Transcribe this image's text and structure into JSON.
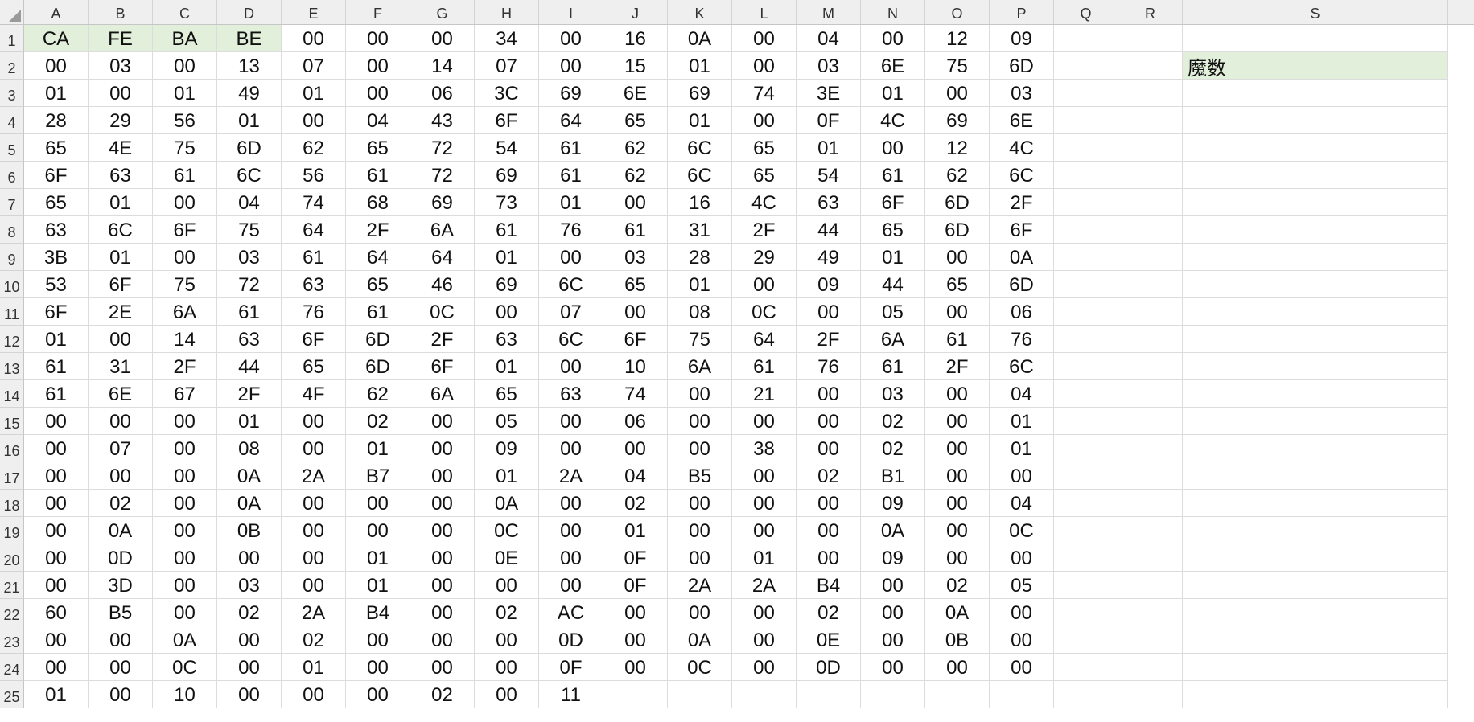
{
  "sheet": {
    "corner_icon": "select-all-triangle",
    "highlight_color": "#e2efda",
    "columns": [
      "A",
      "B",
      "C",
      "D",
      "E",
      "F",
      "G",
      "H",
      "I",
      "J",
      "K",
      "L",
      "M",
      "N",
      "O",
      "P",
      "Q",
      "R",
      "S"
    ],
    "rows": [
      [
        "CA",
        "FE",
        "BA",
        "BE",
        "00",
        "00",
        "00",
        "34",
        "00",
        "16",
        "0A",
        "00",
        "04",
        "00",
        "12",
        "09",
        "",
        "",
        ""
      ],
      [
        "00",
        "03",
        "00",
        "13",
        "07",
        "00",
        "14",
        "07",
        "00",
        "15",
        "01",
        "00",
        "03",
        "6E",
        "75",
        "6D",
        "",
        "",
        "魔数"
      ],
      [
        "01",
        "00",
        "01",
        "49",
        "01",
        "00",
        "06",
        "3C",
        "69",
        "6E",
        "69",
        "74",
        "3E",
        "01",
        "00",
        "03",
        "",
        "",
        ""
      ],
      [
        "28",
        "29",
        "56",
        "01",
        "00",
        "04",
        "43",
        "6F",
        "64",
        "65",
        "01",
        "00",
        "0F",
        "4C",
        "69",
        "6E",
        "",
        "",
        ""
      ],
      [
        "65",
        "4E",
        "75",
        "6D",
        "62",
        "65",
        "72",
        "54",
        "61",
        "62",
        "6C",
        "65",
        "01",
        "00",
        "12",
        "4C",
        "",
        "",
        ""
      ],
      [
        "6F",
        "63",
        "61",
        "6C",
        "56",
        "61",
        "72",
        "69",
        "61",
        "62",
        "6C",
        "65",
        "54",
        "61",
        "62",
        "6C",
        "",
        "",
        ""
      ],
      [
        "65",
        "01",
        "00",
        "04",
        "74",
        "68",
        "69",
        "73",
        "01",
        "00",
        "16",
        "4C",
        "63",
        "6F",
        "6D",
        "2F",
        "",
        "",
        ""
      ],
      [
        "63",
        "6C",
        "6F",
        "75",
        "64",
        "2F",
        "6A",
        "61",
        "76",
        "61",
        "31",
        "2F",
        "44",
        "65",
        "6D",
        "6F",
        "",
        "",
        ""
      ],
      [
        "3B",
        "01",
        "00",
        "03",
        "61",
        "64",
        "64",
        "01",
        "00",
        "03",
        "28",
        "29",
        "49",
        "01",
        "00",
        "0A",
        "",
        "",
        ""
      ],
      [
        "53",
        "6F",
        "75",
        "72",
        "63",
        "65",
        "46",
        "69",
        "6C",
        "65",
        "01",
        "00",
        "09",
        "44",
        "65",
        "6D",
        "",
        "",
        ""
      ],
      [
        "6F",
        "2E",
        "6A",
        "61",
        "76",
        "61",
        "0C",
        "00",
        "07",
        "00",
        "08",
        "0C",
        "00",
        "05",
        "00",
        "06",
        "",
        "",
        ""
      ],
      [
        "01",
        "00",
        "14",
        "63",
        "6F",
        "6D",
        "2F",
        "63",
        "6C",
        "6F",
        "75",
        "64",
        "2F",
        "6A",
        "61",
        "76",
        "",
        "",
        ""
      ],
      [
        "61",
        "31",
        "2F",
        "44",
        "65",
        "6D",
        "6F",
        "01",
        "00",
        "10",
        "6A",
        "61",
        "76",
        "61",
        "2F",
        "6C",
        "",
        "",
        ""
      ],
      [
        "61",
        "6E",
        "67",
        "2F",
        "4F",
        "62",
        "6A",
        "65",
        "63",
        "74",
        "00",
        "21",
        "00",
        "03",
        "00",
        "04",
        "",
        "",
        ""
      ],
      [
        "00",
        "00",
        "00",
        "01",
        "00",
        "02",
        "00",
        "05",
        "00",
        "06",
        "00",
        "00",
        "00",
        "02",
        "00",
        "01",
        "",
        "",
        ""
      ],
      [
        "00",
        "07",
        "00",
        "08",
        "00",
        "01",
        "00",
        "09",
        "00",
        "00",
        "00",
        "38",
        "00",
        "02",
        "00",
        "01",
        "",
        "",
        ""
      ],
      [
        "00",
        "00",
        "00",
        "0A",
        "2A",
        "B7",
        "00",
        "01",
        "2A",
        "04",
        "B5",
        "00",
        "02",
        "B1",
        "00",
        "00",
        "",
        "",
        ""
      ],
      [
        "00",
        "02",
        "00",
        "0A",
        "00",
        "00",
        "00",
        "0A",
        "00",
        "02",
        "00",
        "00",
        "00",
        "09",
        "00",
        "04",
        "",
        "",
        ""
      ],
      [
        "00",
        "0A",
        "00",
        "0B",
        "00",
        "00",
        "00",
        "0C",
        "00",
        "01",
        "00",
        "00",
        "00",
        "0A",
        "00",
        "0C",
        "",
        "",
        ""
      ],
      [
        "00",
        "0D",
        "00",
        "00",
        "00",
        "01",
        "00",
        "0E",
        "00",
        "0F",
        "00",
        "01",
        "00",
        "09",
        "00",
        "00",
        "",
        "",
        ""
      ],
      [
        "00",
        "3D",
        "00",
        "03",
        "00",
        "01",
        "00",
        "00",
        "00",
        "0F",
        "2A",
        "2A",
        "B4",
        "00",
        "02",
        "05",
        "",
        "",
        ""
      ],
      [
        "60",
        "B5",
        "00",
        "02",
        "2A",
        "B4",
        "00",
        "02",
        "AC",
        "00",
        "00",
        "00",
        "02",
        "00",
        "0A",
        "00",
        "",
        "",
        ""
      ],
      [
        "00",
        "00",
        "0A",
        "00",
        "02",
        "00",
        "00",
        "00",
        "0D",
        "00",
        "0A",
        "00",
        "0E",
        "00",
        "0B",
        "00",
        "",
        "",
        ""
      ],
      [
        "00",
        "00",
        "0C",
        "00",
        "01",
        "00",
        "00",
        "00",
        "0F",
        "00",
        "0C",
        "00",
        "0D",
        "00",
        "00",
        "00",
        "",
        "",
        ""
      ],
      [
        "01",
        "00",
        "10",
        "00",
        "00",
        "00",
        "02",
        "00",
        "11",
        "",
        "",
        "",
        "",
        "",
        "",
        "",
        "",
        "",
        ""
      ]
    ]
  }
}
